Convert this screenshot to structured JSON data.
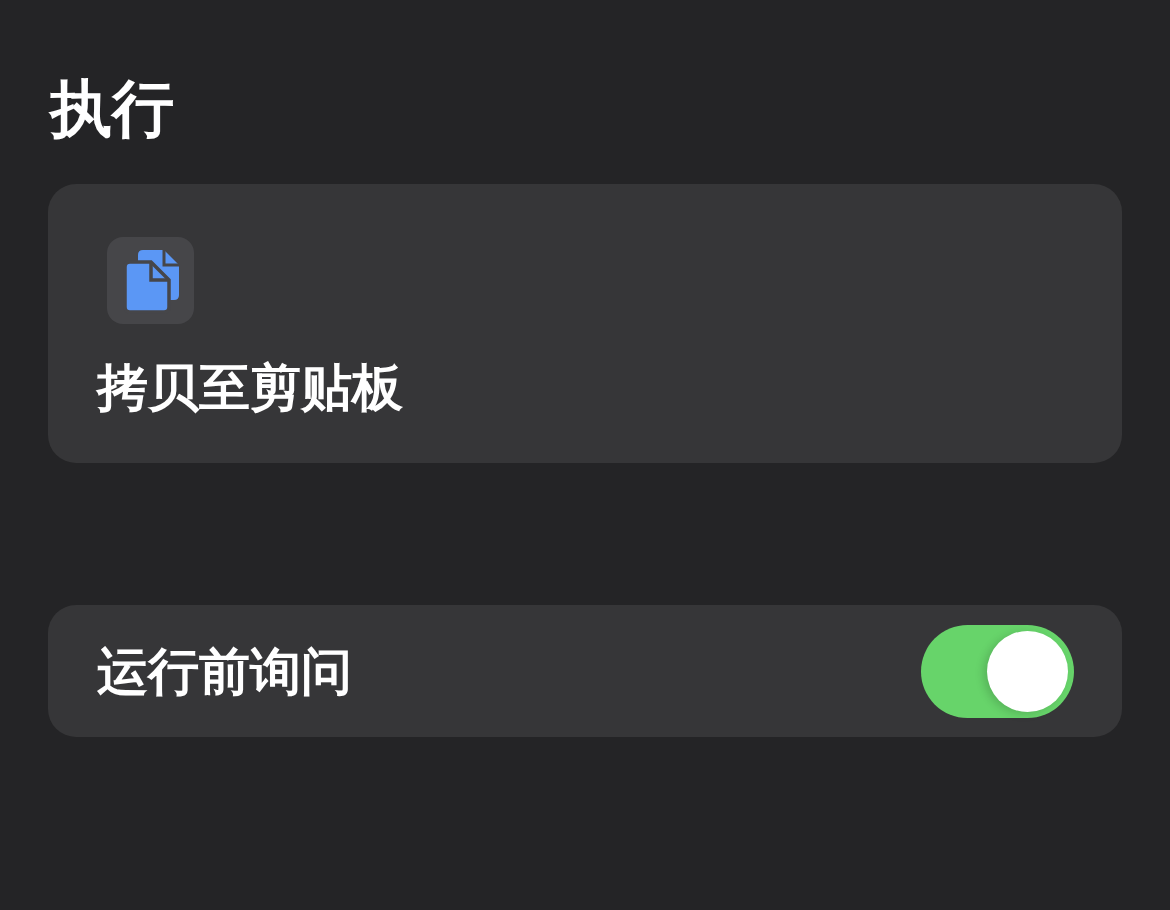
{
  "section": {
    "title": "执行"
  },
  "action": {
    "title": "拷贝至剪贴板"
  },
  "settings": [
    {
      "label": "运行前询问",
      "on": true
    }
  ]
}
